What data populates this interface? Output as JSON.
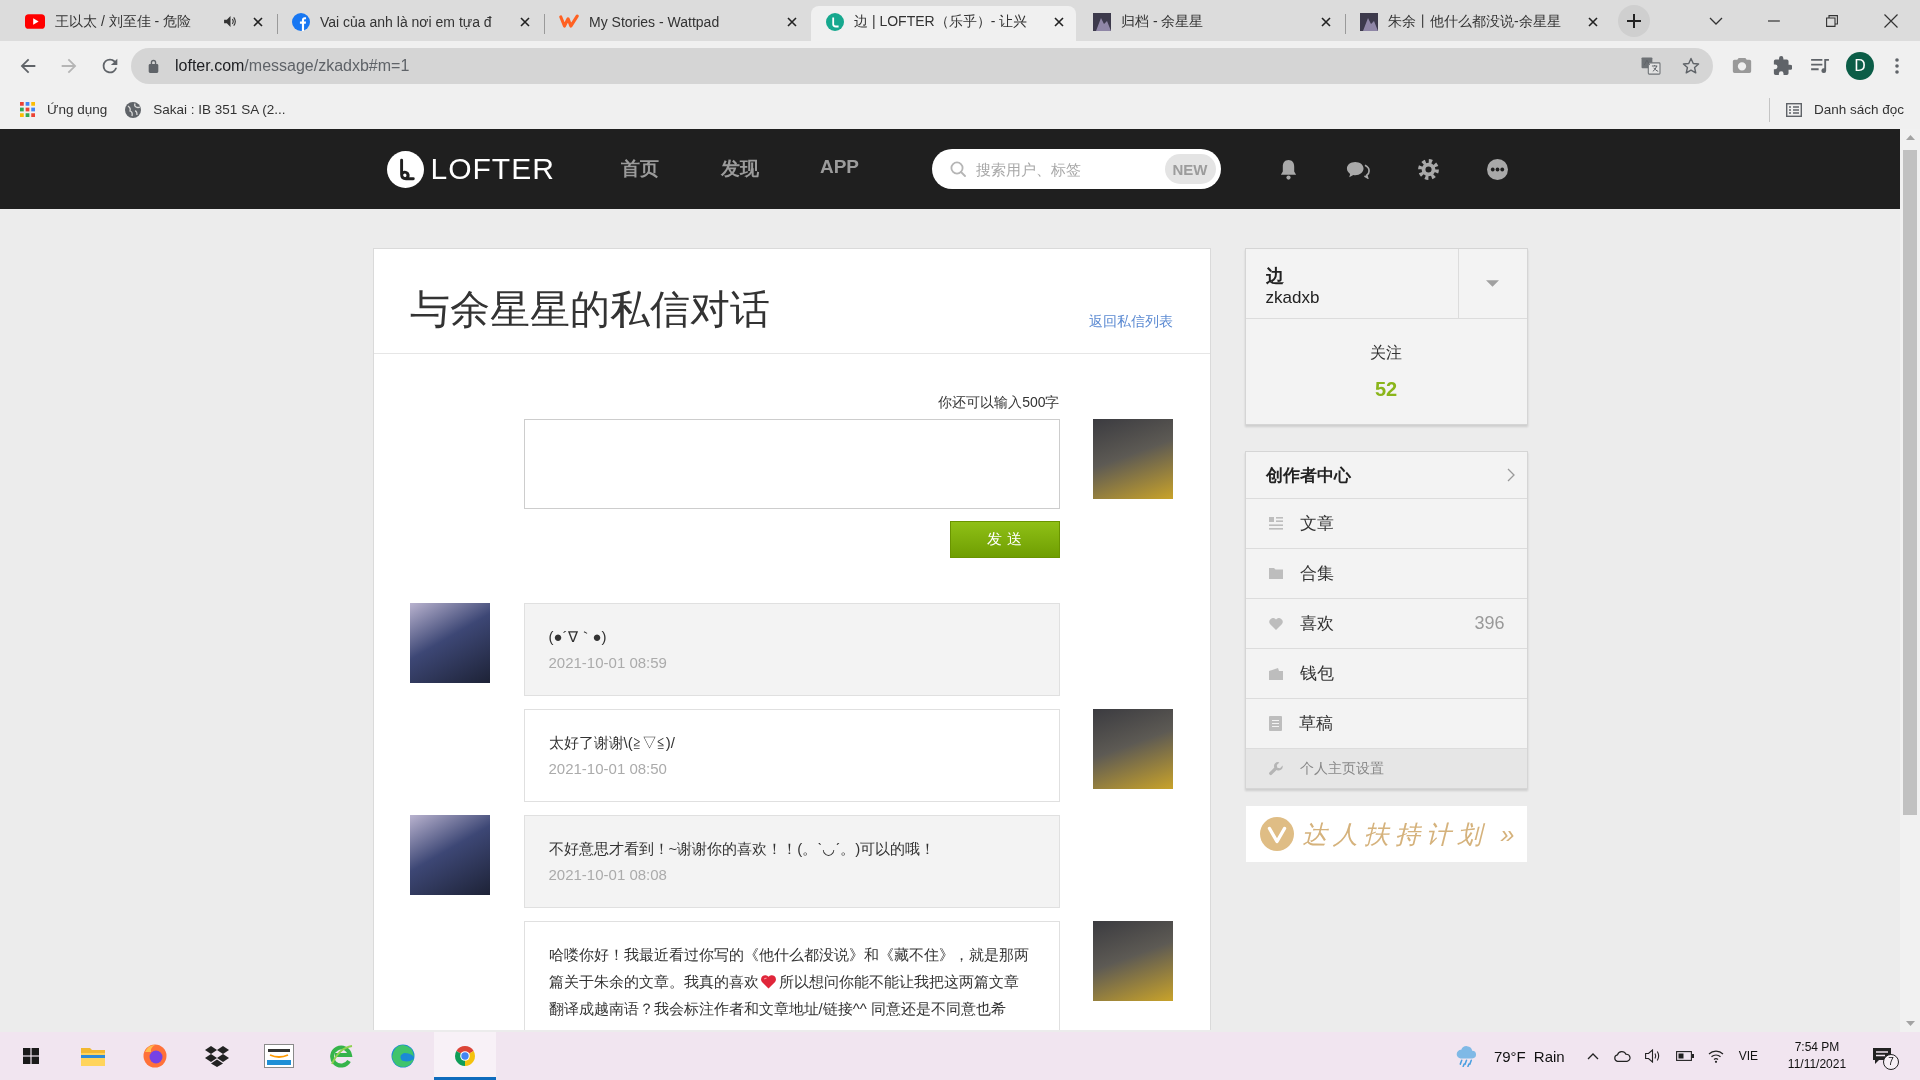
{
  "browser": {
    "tabs": [
      {
        "kind": "youtube",
        "title": "王以太 / 刘至佳 - 危险",
        "audio": true,
        "selected": false
      },
      {
        "kind": "facebook",
        "title": "Vai của anh là nơi em tựa đ",
        "audio": false,
        "selected": false
      },
      {
        "kind": "wattpad",
        "title": "My Stories - Wattpad",
        "audio": false,
        "selected": false
      },
      {
        "kind": "lofter",
        "title": "边 | LOFTER（乐乎）- 让兴",
        "audio": false,
        "selected": true
      },
      {
        "kind": "thumbnail",
        "title": "归档 - 余星星",
        "audio": false,
        "selected": false
      },
      {
        "kind": "thumbnail",
        "title": "朱余丨他什么都没说-余星星",
        "audio": false,
        "selected": false
      }
    ],
    "address": "lofter.com/message/zkadxb#m=1",
    "profile_initial": "D",
    "bookmarks": [
      {
        "kind": "apps",
        "label": "Ứng dụng"
      },
      {
        "kind": "globe",
        "label": "Sakai : IB 351 SA (2..."
      }
    ],
    "reading_list": "Danh sách đọc"
  },
  "site_header": {
    "logo": "LOFTER",
    "nav": [
      "首页",
      "发现",
      "APP"
    ],
    "search": {
      "placeholder": "搜索用户、标签",
      "badge": "NEW"
    }
  },
  "conversation": {
    "title": "与余星星的私信对话",
    "back_link": "返回私信列表",
    "composer": {
      "counter": "你还可以输入500字",
      "send_button": "发 送"
    },
    "messages": [
      {
        "kind": "received",
        "parts": [
          {
            "kind": "text",
            "text": "(●´∇｀●)"
          }
        ],
        "time": "2021-10-01 08:59"
      },
      {
        "kind": "sent",
        "parts": [
          {
            "kind": "text",
            "text": "太好了谢谢\\(≧▽≦)/"
          }
        ],
        "time": "2021-10-01 08:50"
      },
      {
        "kind": "received",
        "parts": [
          {
            "kind": "text",
            "text": "不好意思才看到！~谢谢你的喜欢！！(。ˋ◡ˊ。)可以的哦！"
          }
        ],
        "time": "2021-10-01 08:08"
      },
      {
        "kind": "sent",
        "parts": [
          {
            "kind": "text",
            "text": "哈喽你好！我最近看过你写的《他什么都没说》和《藏不住》，就是那两篇关于朱余的文章。我真的喜欢"
          },
          {
            "kind": "emoji"
          },
          {
            "kind": "text",
            "text": "所以想问你能不能让我把这两篇文章翻译成越南语？我会标注作者和文章地址/链接^^ 同意还是不同意也希"
          }
        ]
      }
    ]
  },
  "sidebar": {
    "profile": {
      "name": "边",
      "username": "zkadxb",
      "follow_label": "关注",
      "follow_count": "52"
    },
    "creator_center": {
      "title": "创作者中心",
      "items": [
        {
          "kind": "articles",
          "label": "文章"
        },
        {
          "kind": "collections",
          "label": "合集"
        },
        {
          "kind": "likes",
          "label": "喜欢",
          "count": "396"
        },
        {
          "kind": "wallet",
          "label": "钱包"
        },
        {
          "kind": "drafts",
          "label": "草稿"
        }
      ],
      "settings": "个人主页设置"
    },
    "banner": "达人扶持计划 »"
  },
  "taskbar": {
    "apps": [
      {
        "kind": "start",
        "selected": false
      },
      {
        "kind": "explorer",
        "selected": false
      },
      {
        "kind": "firefox",
        "selected": false
      },
      {
        "kind": "dropbox",
        "selected": false
      },
      {
        "kind": "amazon",
        "selected": false
      },
      {
        "kind": "ie",
        "selected": false
      },
      {
        "kind": "edge",
        "selected": false
      },
      {
        "kind": "chrome",
        "selected": true
      }
    ],
    "weather": {
      "temperature": "79°F",
      "condition": "Rain"
    },
    "language": "VIE",
    "time": "7:54 PM",
    "date": "11/11/2021",
    "notifications": "7"
  }
}
